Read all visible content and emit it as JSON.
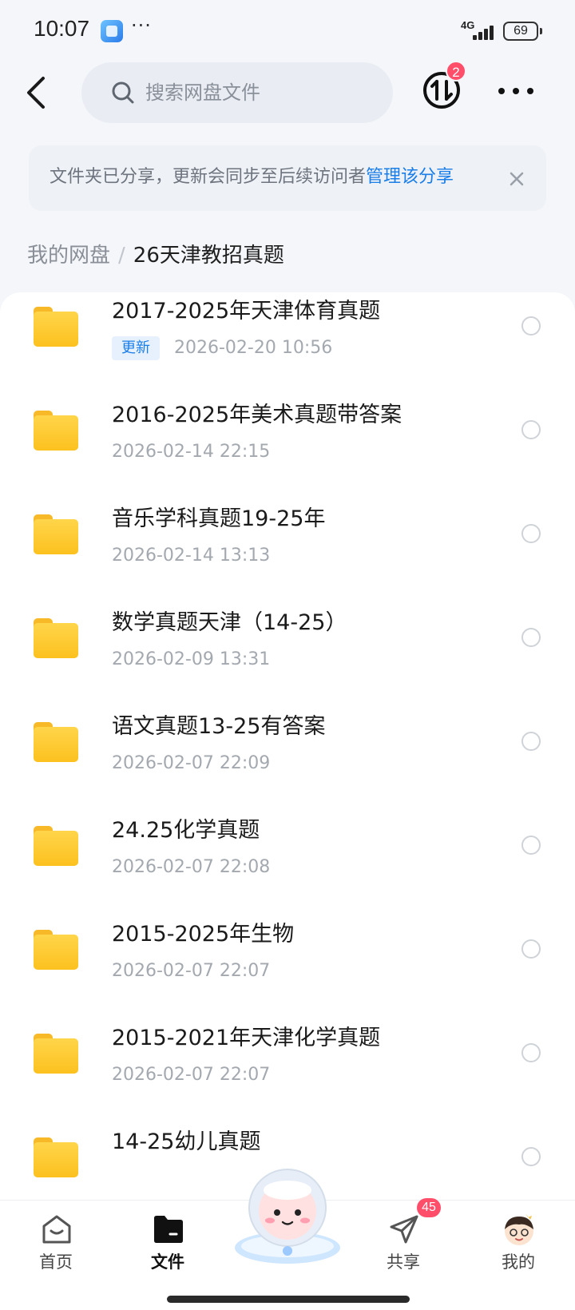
{
  "status_bar": {
    "time": "10:07",
    "more": "···",
    "network": "4G",
    "battery": "69"
  },
  "header": {
    "search_placeholder": "搜索网盘文件",
    "transfer_badge": "2"
  },
  "notice": {
    "text": "文件夹已分享，更新会同步至后续访问者",
    "link": "管理该分享"
  },
  "breadcrumb": {
    "root": "我的网盘",
    "separator": "/",
    "current": "26天津教招真题"
  },
  "files": [
    {
      "name": "2017-2025年天津体育真题",
      "tag": "更新",
      "date": "2026-02-20  10:56"
    },
    {
      "name": "2016-2025年美术真题带答案",
      "date": "2026-02-14  22:15"
    },
    {
      "name": "音乐学科真题19-25年",
      "date": "2026-02-14  13:13"
    },
    {
      "name": "数学真题天津（14-25）",
      "date": "2026-02-09  13:31"
    },
    {
      "name": "语文真题13-25有答案",
      "date": "2026-02-07  22:09"
    },
    {
      "name": "24.25化学真题",
      "date": "2026-02-07  22:08"
    },
    {
      "name": "2015-2025年生物",
      "date": "2026-02-07  22:07"
    },
    {
      "name": "2015-2021年天津化学真题",
      "date": "2026-02-07  22:07"
    },
    {
      "name": "14-25幼儿真题"
    }
  ],
  "bottom_nav": {
    "home": "首页",
    "files": "文件",
    "share": "共享",
    "share_badge": "45",
    "me": "我的"
  },
  "colors": {
    "accent": "#1a7ee8",
    "folder": "#fcc11f",
    "badge": "#ff4d6a"
  }
}
